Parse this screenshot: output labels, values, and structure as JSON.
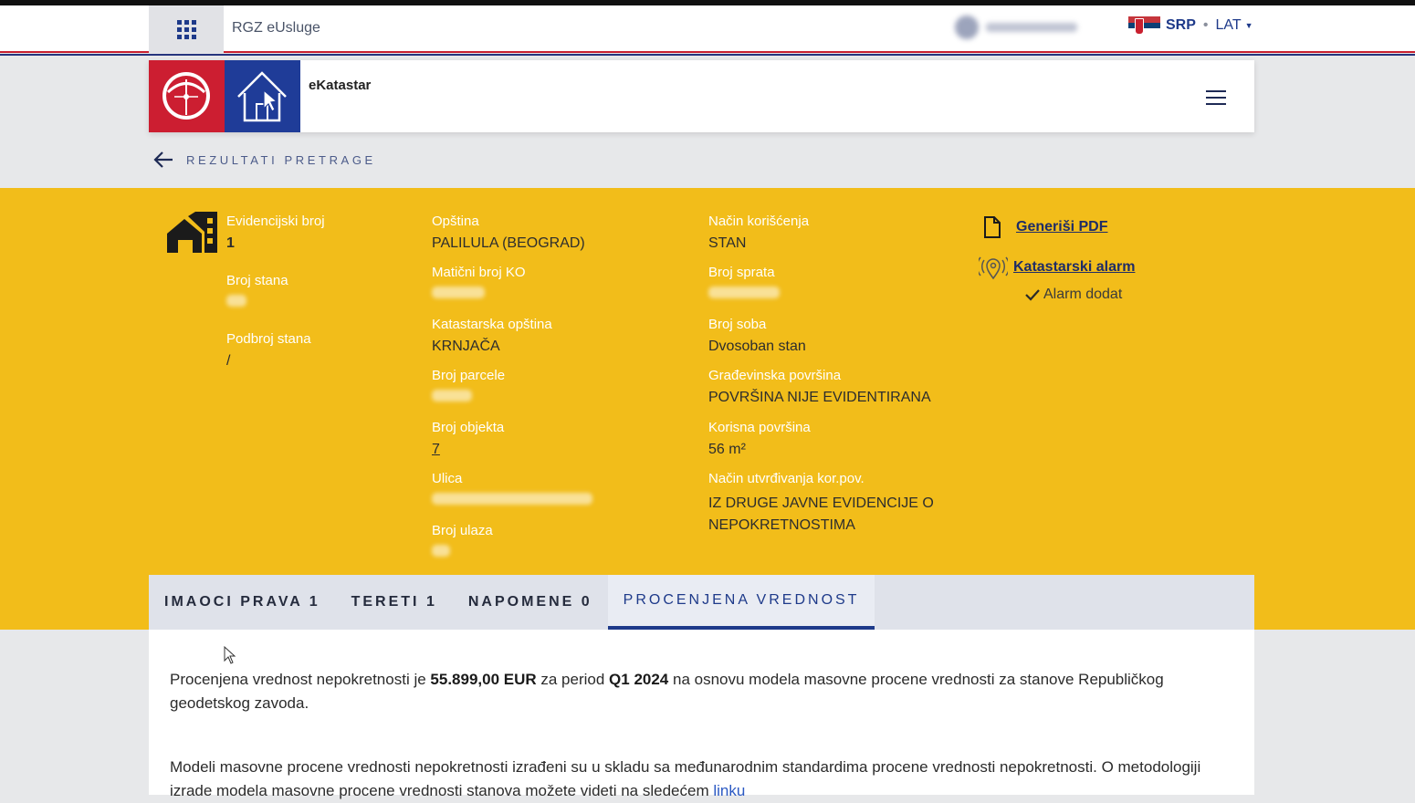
{
  "topbar": {
    "brand": "RGZ eUsluge",
    "lang_primary": "SRP",
    "lang_secondary": "LAT"
  },
  "header": {
    "app_title": "eKatastar"
  },
  "back_link": "REZULTATI PRETRAGE",
  "property": {
    "col1": [
      {
        "label": "Evidencijski broj",
        "value": "1"
      },
      {
        "label": "Broj stana",
        "value": ""
      },
      {
        "label": "Podbroj stana",
        "value": "/"
      }
    ],
    "col2": [
      {
        "label": "Opština",
        "value": "PALILULA (BEOGRAD)"
      },
      {
        "label": "Matični broj KO",
        "value": ""
      },
      {
        "label": "Katastarska opština",
        "value": "KRNJAČA"
      },
      {
        "label": "Broj parcele",
        "value": ""
      },
      {
        "label": "Broj objekta",
        "value": "7"
      },
      {
        "label": "Ulica",
        "value": ""
      },
      {
        "label": "Broj ulaza",
        "value": ""
      }
    ],
    "col3": [
      {
        "label": "Način korišćenja",
        "value": "STAN"
      },
      {
        "label": "Broj sprata",
        "value": ""
      },
      {
        "label": "Broj soba",
        "value": "Dvosoban stan"
      },
      {
        "label": "Građevinska površina",
        "value": "POVRŠINA NIJE EVIDENTIRANA"
      },
      {
        "label": "Korisna površina",
        "value": "56 m²"
      },
      {
        "label": "Način utvrđivanja kor.pov.",
        "value": "IZ DRUGE JAVNE EVIDENCIJE O NEPOKRETNOSTIMA"
      }
    ]
  },
  "actions": {
    "pdf": "Generiši PDF",
    "alarm": "Katastarski alarm",
    "alarm_status": "Alarm dodat"
  },
  "tabs": [
    {
      "label": "IMAOCI PRAVA 1"
    },
    {
      "label": "TERETI 1"
    },
    {
      "label": "NAPOMENE 0"
    },
    {
      "label": "PROCENJENA VREDNOST",
      "active": true
    }
  ],
  "valuation": {
    "p1_prefix": "Procenjena vrednost nepokretnosti je ",
    "amount": "55.899,00 EUR",
    "p1_mid": " za period ",
    "period": "Q1 2024",
    "p1_suffix": " na osnovu modela masovne procene vrednosti za stanove Republičkog geodetskog zavoda.",
    "p2_text": "Modeli masovne procene vrednosti nepokretnosti izrađeni su u skladu sa međunarodnim standardima procene vrednosti nepokretnosti. O metodologiji izrade modela masovne procene vrednosti stanova možete videti na sledećem ",
    "p2_link": "linku"
  },
  "colors": {
    "yellow": "#f2bd1a",
    "navy": "#1e3a8a",
    "red": "#cc1e31",
    "logo_blue": "#1f3c98"
  },
  "icons": [
    "apps-grid-icon",
    "serbia-flag-icon",
    "rgz-logo-icon",
    "home-cursor-icon",
    "menu-icon",
    "arrow-left-icon",
    "building-icon",
    "document-icon",
    "location-alarm-icon",
    "check-icon",
    "mouse-cursor-icon"
  ]
}
